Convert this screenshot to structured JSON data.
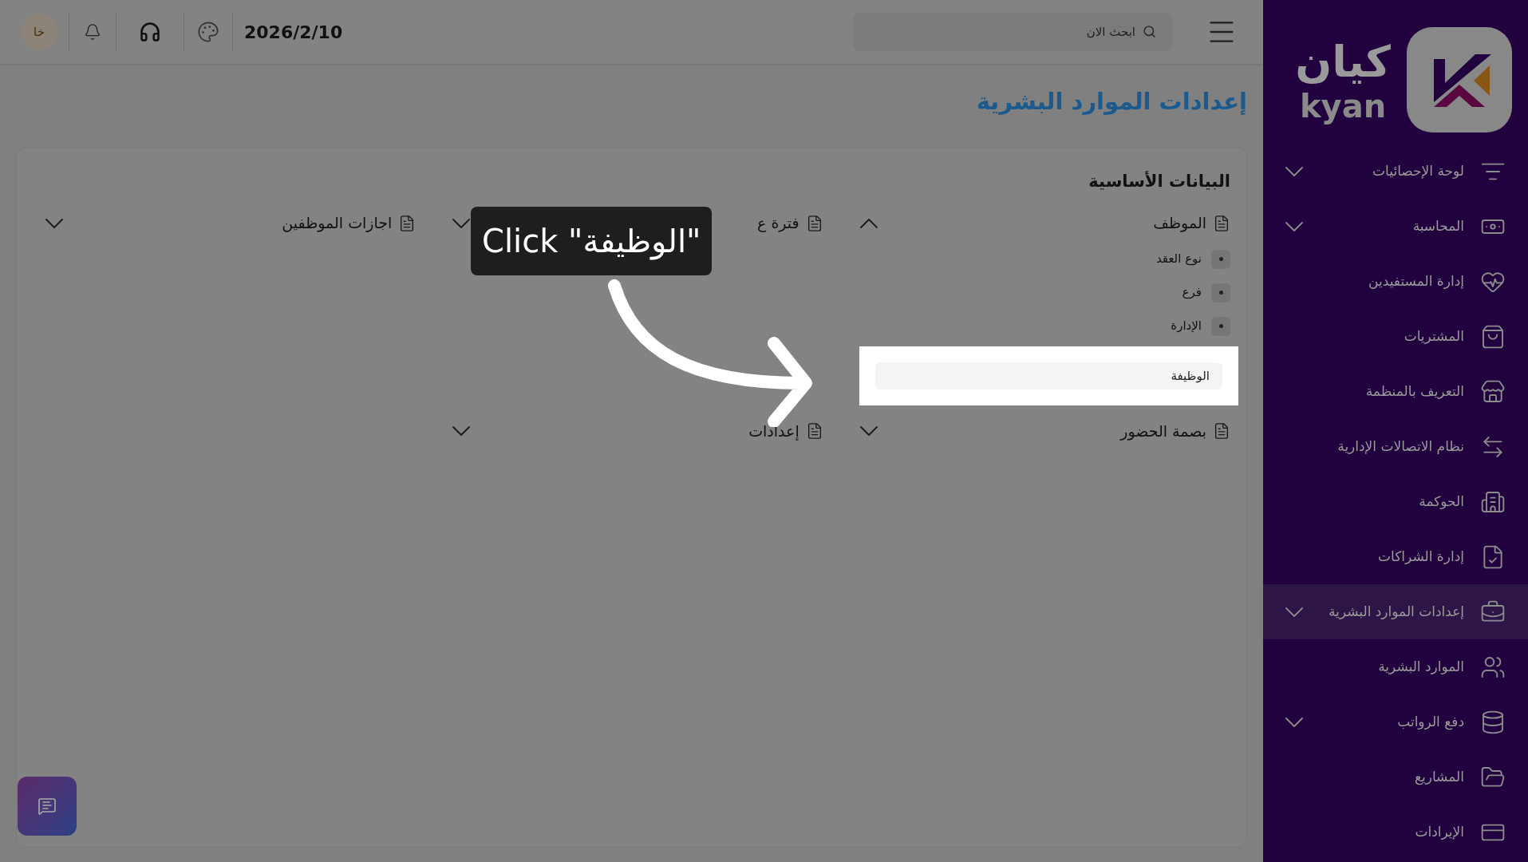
{
  "logo": {
    "name_ar": "كيان",
    "name_en": "kyan"
  },
  "sidebar": {
    "items": [
      {
        "label": "لوحة الإحصائيات",
        "has_submenu": true,
        "selected": false
      },
      {
        "label": "المحاسبة",
        "has_submenu": true,
        "selected": false
      },
      {
        "label": "إدارة المستفيدين",
        "has_submenu": false,
        "selected": false
      },
      {
        "label": "المشتريات",
        "has_submenu": false,
        "selected": false
      },
      {
        "label": "التعريف بالمنظمة",
        "has_submenu": false,
        "selected": false
      },
      {
        "label": "نظام الاتصالات الإدارية",
        "has_submenu": false,
        "selected": false
      },
      {
        "label": "الحوكمة",
        "has_submenu": false,
        "selected": false
      },
      {
        "label": "إدارة الشراكات",
        "has_submenu": false,
        "selected": false
      },
      {
        "label": "إعدادات الموارد البشرية",
        "has_submenu": true,
        "selected": true
      },
      {
        "label": "الموارد البشرية",
        "has_submenu": false,
        "selected": false
      },
      {
        "label": "دفع الرواتب",
        "has_submenu": true,
        "selected": false
      },
      {
        "label": "المشاريع",
        "has_submenu": false,
        "selected": false
      },
      {
        "label": "الإيرادات",
        "has_submenu": false,
        "selected": false
      }
    ]
  },
  "top_bar": {
    "search": {
      "placeholder": "ابحث الان"
    },
    "date": "2026/2/10",
    "avatar": "خا"
  },
  "page_title": "إعدادات الموارد البشرية",
  "section": {
    "title": "البيانات الأساسية",
    "accordions": [
      {
        "label": "الموظف",
        "expanded": true,
        "children": [
          {
            "label": "نوع العقد",
            "highlighted": false
          },
          {
            "label": "فرع",
            "highlighted": false
          },
          {
            "label": "الإدارة",
            "highlighted": false
          },
          {
            "label": "الوظيفة",
            "highlighted": true
          }
        ]
      },
      {
        "label": "فترة ع",
        "expanded": false
      },
      {
        "label": "اجازات الموظفين",
        "expanded": false
      },
      {
        "label": "بصمة الحضور",
        "expanded": false
      },
      {
        "label": "إعدادات",
        "expanded": false
      }
    ]
  },
  "callout": {
    "text": "Click \"الوظيفة\""
  }
}
